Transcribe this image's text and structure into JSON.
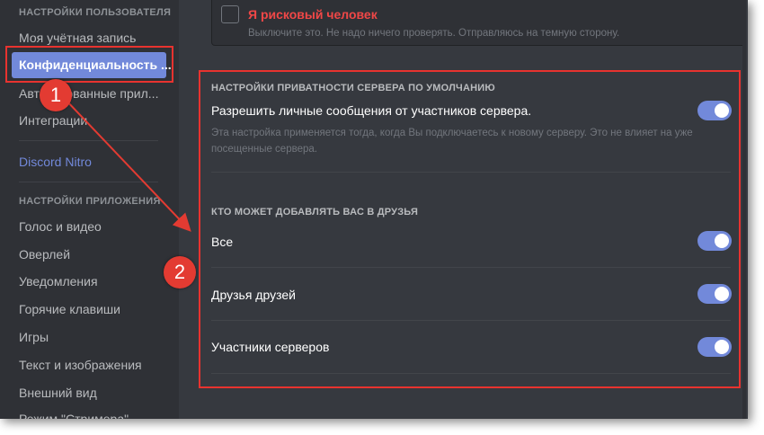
{
  "sidebar": {
    "user_settings_header": "НАСТРОЙКИ ПОЛЬЗОВАТЕЛЯ",
    "user_items": [
      {
        "label": "Моя учётная запись"
      },
      {
        "label": "Конфиденциальность ..."
      },
      {
        "label": "Авторизованные прил..."
      },
      {
        "label": "Интеграции"
      }
    ],
    "nitro_label": "Discord Nitro",
    "app_settings_header": "НАСТРОЙКИ ПРИЛОЖЕНИЯ",
    "app_items": [
      {
        "label": "Голос и видео"
      },
      {
        "label": "Оверлей"
      },
      {
        "label": "Уведомления"
      },
      {
        "label": "Горячие клавиши"
      },
      {
        "label": "Игры"
      },
      {
        "label": "Текст и изображения"
      },
      {
        "label": "Внешний вид"
      },
      {
        "label": "Режим \"Стримера\""
      }
    ]
  },
  "risk": {
    "title": "Я рисковый человек",
    "description": "Выключите это. Не надо ничего проверять. Отправляюсь на темную сторону."
  },
  "server_privacy": {
    "section_title": "НАСТРОЙКИ ПРИВАТНОСТИ СЕРВЕРА ПО УМОЛЧАНИЮ",
    "dm_label": "Разрешить личные сообщения от участников сервера.",
    "dm_description": "Эта настройка применяется тогда, когда Вы подключаетесь к новому серверу. Это не влияет на уже посещенные сервера.",
    "dm_enabled": true
  },
  "friends": {
    "section_title": "КТО МОЖЕТ ДОБАВЛЯТЬ ВАС В ДРУЗЬЯ",
    "options": [
      {
        "label": "Все",
        "enabled": true
      },
      {
        "label": "Друзья друзей",
        "enabled": true
      },
      {
        "label": "Участники серверов",
        "enabled": true
      }
    ]
  },
  "annotations": {
    "badge1": "1",
    "badge2": "2"
  },
  "colors": {
    "accent": "#7289da",
    "danger": "#f04747",
    "annotation_red": "#e33b32"
  }
}
